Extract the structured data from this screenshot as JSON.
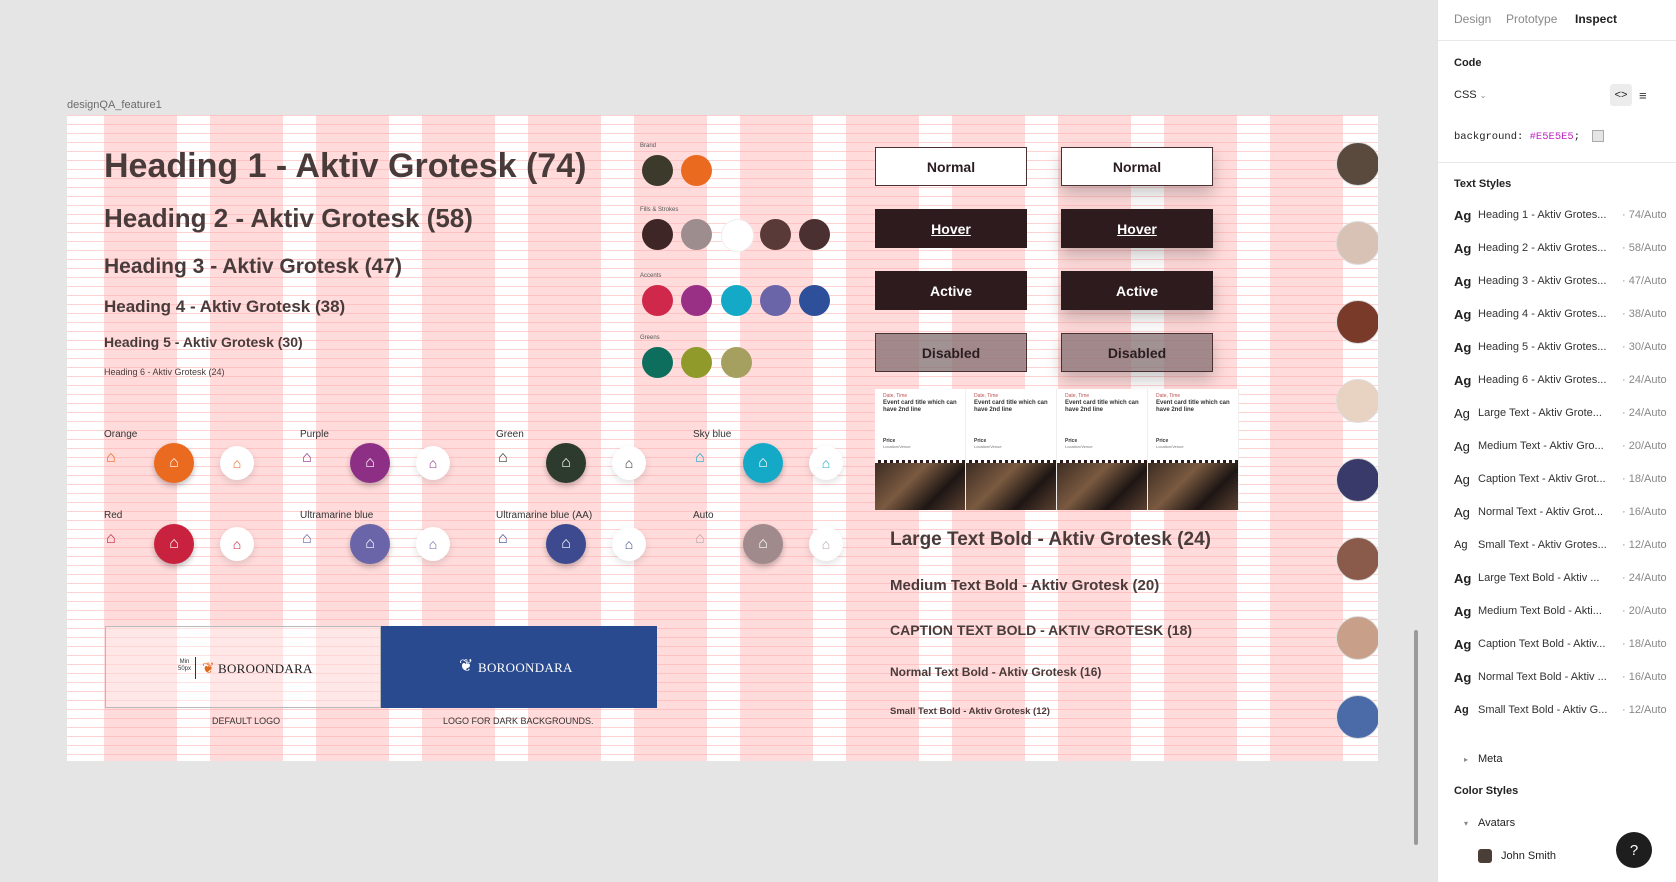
{
  "frame": {
    "title": "designQA_feature1"
  },
  "headings": [
    "Heading 1 - Aktiv Grotesk (74)",
    "Heading 2 - Aktiv Grotesk (58)",
    "Heading 3 - Aktiv Grotesk (47)",
    "Heading 4 - Aktiv Grotesk (38)",
    "Heading 5 - Aktiv Grotesk (30)",
    "Heading 6 - Aktiv Grotesk (24)"
  ],
  "palette": {
    "brand": {
      "label": "Brand",
      "colors": [
        "#3c3a2a",
        "#ea6a1f"
      ]
    },
    "fills": {
      "label": "Fills & Strokes",
      "colors": [
        "#3e2526",
        "#9e8d8f",
        "#ffffff",
        "#5a3a38",
        "#4a3030"
      ]
    },
    "accents": {
      "label": "Accents",
      "colors": [
        "#d0284a",
        "#9a2f86",
        "#15a9c8",
        "#6a64a8",
        "#2e4f9a"
      ]
    },
    "greens": {
      "label": "Greens",
      "colors": [
        "#0e6e5e",
        "#8f9a2a",
        "#a5a060"
      ]
    }
  },
  "icon_sets": [
    {
      "label": "Orange",
      "color": "#ea6a1f"
    },
    {
      "label": "Purple",
      "color": "#8e2f86"
    },
    {
      "label": "Green",
      "color": "#2d3a2e"
    },
    {
      "label": "Sky blue",
      "color": "#15a9c8"
    },
    {
      "label": "Red",
      "color": "#c8223f"
    },
    {
      "label": "Ultramarine blue",
      "color": "#6a64a8"
    },
    {
      "label": "Ultramarine blue (AA)",
      "color": "#3d4a8f"
    },
    {
      "label": "Auto",
      "color": "#a08a8c"
    }
  ],
  "logos": {
    "default": {
      "label": "DEFAULT LOGO",
      "text": "BOROONDARA",
      "min": "Min",
      "min_size": "50px"
    },
    "dark": {
      "label": "LOGO FOR DARK BACKGROUNDS.",
      "text": "BOROONDARA"
    }
  },
  "buttons": {
    "normal": "Normal",
    "hover": "Hover",
    "active": "Active",
    "disabled": "Disabled"
  },
  "event_card": {
    "date": "Date, Time",
    "title": "Event card title which can have 2nd line",
    "price": "Price",
    "venue": "Location/Venue"
  },
  "bold_texts": [
    "Large Text Bold - Aktiv Grotesk (24)",
    "Medium Text Bold - Aktiv Grotesk (20)",
    "CAPTION TEXT BOLD - AKTIV GROTESK (18)",
    "Normal Text Bold - Aktiv Grotesk (16)",
    "Small Text  Bold - Aktiv Grotesk (12)"
  ],
  "panel": {
    "tabs": [
      "Design",
      "Prototype",
      "Inspect"
    ],
    "code_title": "Code",
    "code_lang": "CSS",
    "code_prop": "background:",
    "code_value": "#E5E5E5",
    "code_semicolon": ";",
    "text_styles_title": "Text Styles",
    "text_styles": [
      {
        "ag": "Ag",
        "name": "Heading 1 - Aktiv Grotes...",
        "spec": "· 74/Auto"
      },
      {
        "ag": "Ag",
        "name": "Heading 2 - Aktiv Grotes...",
        "spec": "· 58/Auto"
      },
      {
        "ag": "Ag",
        "name": "Heading 3 - Aktiv Grotes...",
        "spec": "· 47/Auto"
      },
      {
        "ag": "Ag",
        "name": "Heading 4 - Aktiv Grotes...",
        "spec": "· 38/Auto"
      },
      {
        "ag": "Ag",
        "name": "Heading 5 - Aktiv Grotes...",
        "spec": "· 30/Auto"
      },
      {
        "ag": "Ag",
        "name": "Heading 6 - Aktiv Grotes...",
        "spec": "· 24/Auto"
      },
      {
        "ag": "Ag",
        "name": "Large Text - Aktiv Grote...",
        "spec": "· 24/Auto"
      },
      {
        "ag": "Ag",
        "name": "Medium Text - Aktiv Gro...",
        "spec": "· 20/Auto"
      },
      {
        "ag": "Ag",
        "name": "Caption Text - Aktiv Grot...",
        "spec": "· 18/Auto"
      },
      {
        "ag": "Ag",
        "name": "Normal Text - Aktiv Grot...",
        "spec": "· 16/Auto"
      },
      {
        "ag": "Ag",
        "name": "Small Text - Aktiv Grotes...",
        "spec": "· 12/Auto"
      },
      {
        "ag": "Ag",
        "name": "Large Text Bold - Aktiv ...",
        "spec": "· 24/Auto"
      },
      {
        "ag": "Ag",
        "name": "Medium Text Bold - Akti...",
        "spec": "· 20/Auto"
      },
      {
        "ag": "Ag",
        "name": "Caption Text Bold - Aktiv...",
        "spec": "· 18/Auto"
      },
      {
        "ag": "Ag",
        "name": "Normal Text Bold - Aktiv ...",
        "spec": "· 16/Auto"
      },
      {
        "ag": "Ag",
        "name": "Small Text Bold - Aktiv G...",
        "spec": "· 12/Auto"
      }
    ],
    "meta_label": "Meta",
    "color_styles_title": "Color Styles",
    "avatars_label": "Avatars",
    "avatar_item": "John Smith",
    "help": "?"
  }
}
